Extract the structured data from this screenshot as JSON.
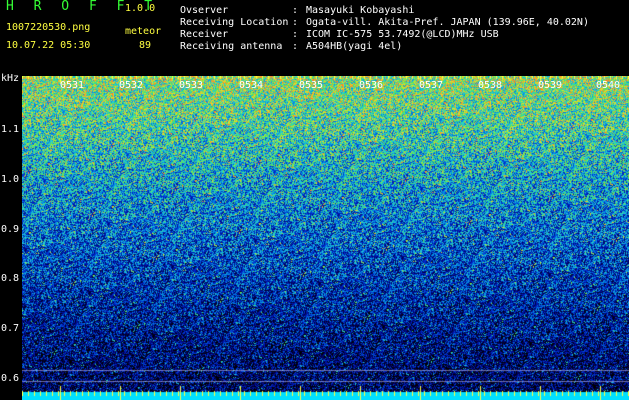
{
  "header": {
    "title": "H R O F F T",
    "version": "1.0.0",
    "filename": "1007220530.png",
    "mode": "meteor",
    "datetime": "10.07.22 05:30",
    "count": "89"
  },
  "station": {
    "rows": [
      {
        "label": "Ovserver",
        "value": "Masayuki Kobayashi"
      },
      {
        "label": "Receiving Location",
        "value": "Ogata-vill. Akita-Pref. JAPAN (139.96E, 40.02N)"
      },
      {
        "label": "Receiver",
        "value": "ICOM IC-575 53.7492(@LCD)MHz USB"
      },
      {
        "label": "Receiving antenna",
        "value": "A504HB(yagi 4el)"
      }
    ]
  },
  "axis": {
    "unit": "kHz",
    "ticks": [
      "1.1",
      "1.0",
      "0.9",
      "0.8",
      "0.7",
      "0.6"
    ]
  },
  "time_labels": [
    "0531",
    "0532",
    "0533",
    "0534",
    "0535",
    "0536",
    "0537",
    "0538",
    "0539",
    "0540"
  ],
  "colors": {
    "text": "#ffffff",
    "title": "#35ff35",
    "ticks": "#ffff40",
    "baseline": "#00e0ff"
  }
}
